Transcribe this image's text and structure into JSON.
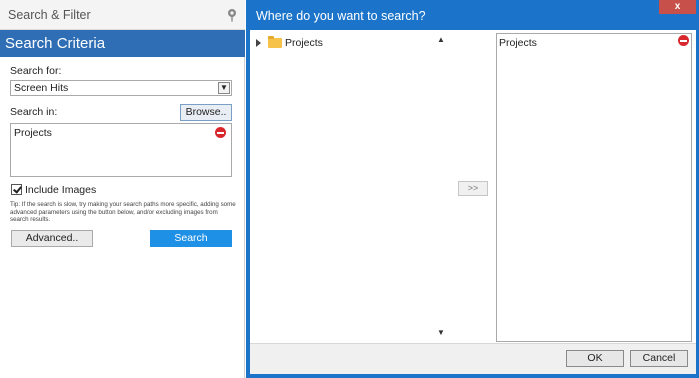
{
  "left_panel": {
    "header_title": "Search & Filter",
    "pin_icon": "pin-icon",
    "criteria_title": "Search Criteria",
    "search_for_label": "Search for:",
    "search_for_value": "Screen Hits",
    "search_in_label": "Search in:",
    "browse_label": "Browse..",
    "search_paths": [
      "Projects"
    ],
    "include_images_label": "Include Images",
    "include_images_checked": true,
    "tip_text": "Tip: If the search is slow, try making your search paths more specific, adding some advanced parameters using the button below, and/or excluding images from search results.",
    "advanced_label": "Advanced..",
    "search_label": "Search",
    "accent_color": "#2f6eb5",
    "search_button_color": "#1e90e6"
  },
  "dialog": {
    "title": "Where do you want to search?",
    "close_label": "x",
    "tree_items": [
      "Projects"
    ],
    "add_label": ">>",
    "selected_items": [
      "Projects"
    ],
    "ok_label": "OK",
    "cancel_label": "Cancel",
    "title_bar_color": "#1b74c9",
    "close_button_color": "#c7504a"
  }
}
